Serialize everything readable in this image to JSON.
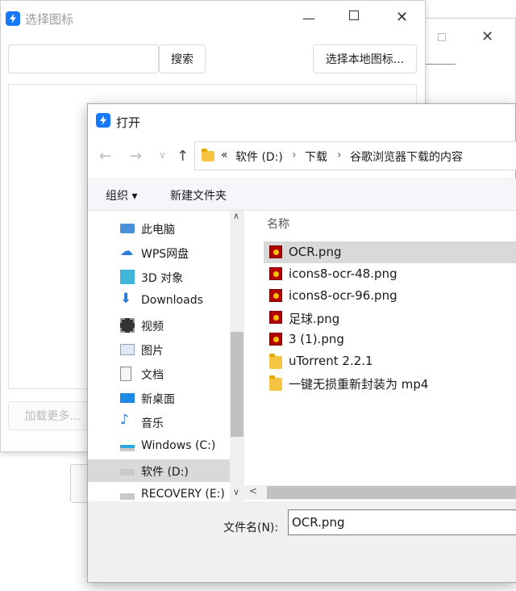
{
  "select_window": {
    "title": "选择图标",
    "search_label": "搜索",
    "local_icon_label": "选择本地图标...",
    "load_more_label": "加载更多...",
    "search_input_value": ""
  },
  "open_dialog": {
    "title": "打开",
    "address": {
      "overflow": "«",
      "crumbs": [
        "软件 (D:)",
        "下载",
        "谷歌浏览器下载的内容"
      ]
    },
    "commands": {
      "organize": "组织 ▾",
      "new_folder": "新建文件夹"
    },
    "nav_items": [
      {
        "label": "此电脑",
        "icon": "computer-icon"
      },
      {
        "label": "WPS网盘",
        "icon": "cloud-icon"
      },
      {
        "label": "3D 对象",
        "icon": "cube-icon"
      },
      {
        "label": "Downloads",
        "icon": "download-icon"
      },
      {
        "label": "视频",
        "icon": "video-icon"
      },
      {
        "label": "图片",
        "icon": "picture-icon"
      },
      {
        "label": "文档",
        "icon": "document-icon"
      },
      {
        "label": "新桌面",
        "icon": "desktop-icon"
      },
      {
        "label": "音乐",
        "icon": "music-icon"
      },
      {
        "label": "Windows (C:)",
        "icon": "windows-drive-icon"
      },
      {
        "label": "软件 (D:)",
        "icon": "drive-icon",
        "selected": true
      },
      {
        "label": "RECOVERY (E:)",
        "icon": "drive-icon"
      }
    ],
    "column_header": "名称",
    "files": [
      {
        "name": "OCR.png",
        "icon": "png-file-icon",
        "selected": true
      },
      {
        "name": "icons8-ocr-48.png",
        "icon": "png-file-icon"
      },
      {
        "name": "icons8-ocr-96.png",
        "icon": "png-file-icon"
      },
      {
        "name": "足球.png",
        "icon": "png-file-icon"
      },
      {
        "name": "3 (1).png",
        "icon": "png-file-icon"
      },
      {
        "name": "uTorrent 2.2.1",
        "icon": "folder-icon"
      },
      {
        "name": "一键无损重新封装为 mp4",
        "icon": "folder-icon"
      }
    ],
    "filename_label": "文件名(N):",
    "filename_value": "OCR.png"
  },
  "colors": {
    "accent": "#1677ff",
    "selection": "#d9d9d9"
  }
}
